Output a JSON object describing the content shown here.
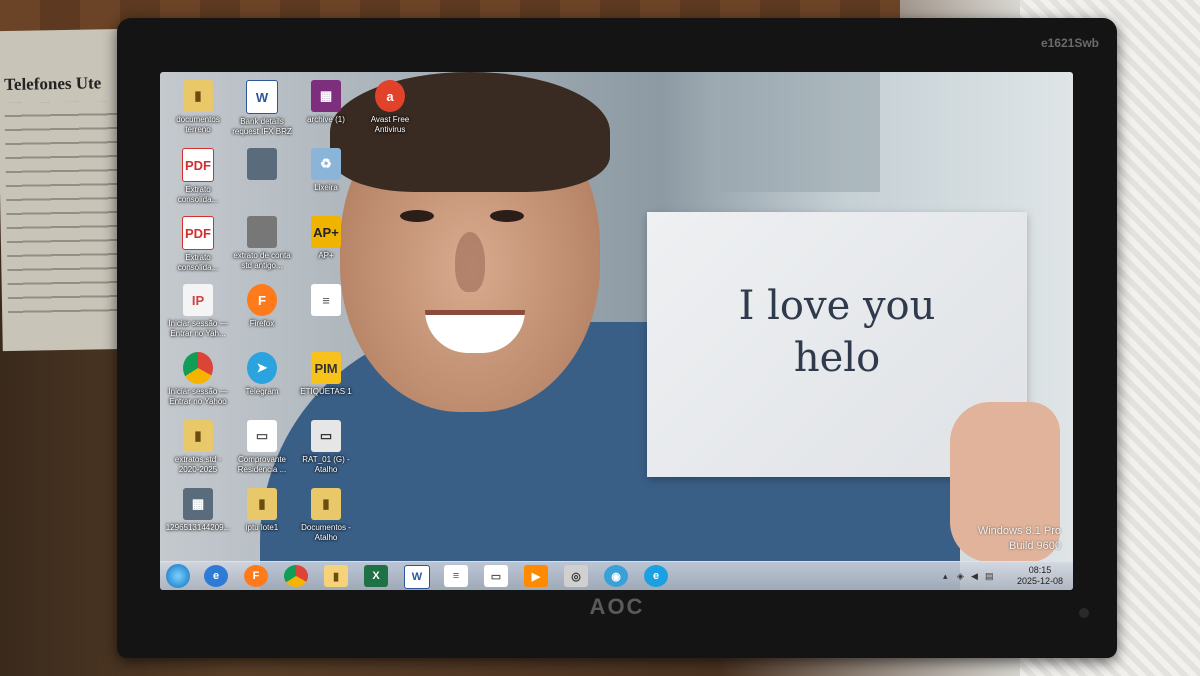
{
  "background": {
    "poster_title": "Telefones Ute"
  },
  "monitor": {
    "brand": "AOC",
    "model": "e1621Swb"
  },
  "wallpaper": {
    "sign_lines": [
      "I love you",
      "helo"
    ]
  },
  "desktop_icons": [
    {
      "label": "documentos terreno",
      "icon": "folder-icon",
      "glyph": "▮"
    },
    {
      "label": "Bank details request IFX BRZ",
      "icon": "word-icon",
      "glyph": "W"
    },
    {
      "label": "archive (1)",
      "icon": "winrar-icon",
      "glyph": "▦"
    },
    {
      "label": "Avast Free Antivirus",
      "icon": "avast-icon",
      "glyph": "a"
    },
    {
      "label": "Extrato consolida...",
      "icon": "pdf-icon",
      "glyph": "PDF"
    },
    {
      "label": "",
      "icon": "image-icon",
      "glyph": ""
    },
    {
      "label": "Lixeira",
      "icon": "recycle-bin-icon",
      "glyph": "♻"
    },
    {
      "label": "",
      "icon": "pdf-icon",
      "glyph": "PDF"
    },
    {
      "label": "Extrato consolida...",
      "icon": "pdf-icon",
      "glyph": "PDF"
    },
    {
      "label": "extrato de conta std antigo...",
      "icon": "file-icon",
      "glyph": ""
    },
    {
      "label": "AP+",
      "icon": "app-icon",
      "glyph": "AP+"
    },
    {
      "label": "Iniciar sessão — Entrar no Yah...",
      "icon": "tab-icon",
      "glyph": "IP"
    },
    {
      "label": "Firefox",
      "icon": "firefox-icon",
      "glyph": "F"
    },
    {
      "label": "",
      "icon": "document-icon",
      "glyph": "≡"
    },
    {
      "label": "Iniciar sessão — Entrar no Yahoo",
      "icon": "chrome-icon",
      "glyph": ""
    },
    {
      "label": "Telegram",
      "icon": "telegram-icon",
      "glyph": "➤"
    },
    {
      "label": "ETIQUETAS 1",
      "icon": "label-app-icon",
      "glyph": "PIM"
    },
    {
      "label": "extratos std - 2020-2025",
      "icon": "folder-icon",
      "glyph": "▮"
    },
    {
      "label": "Comprovante Residencia ...",
      "icon": "document-icon",
      "glyph": "▭"
    },
    {
      "label": "RAT_01 (G) - Atalho",
      "icon": "drive-icon",
      "glyph": "▭"
    },
    {
      "label": "1296513144209...",
      "icon": "image-icon",
      "glyph": "▦"
    },
    {
      "label": "iptu lote1",
      "icon": "folder-icon",
      "glyph": "▮"
    },
    {
      "label": "Documentos - Atalho",
      "icon": "folder-icon",
      "glyph": "▮"
    }
  ],
  "taskbar": {
    "items": [
      {
        "name": "edge-icon",
        "glyph": "e"
      },
      {
        "name": "firefox-icon",
        "glyph": "F"
      },
      {
        "name": "chrome-icon",
        "glyph": ""
      },
      {
        "name": "file-explorer-icon",
        "glyph": "▮"
      },
      {
        "name": "excel-icon",
        "glyph": "X"
      },
      {
        "name": "word-icon",
        "glyph": "W"
      },
      {
        "name": "document-icon",
        "glyph": "≡"
      },
      {
        "name": "document-icon",
        "glyph": "▭"
      },
      {
        "name": "media-player-icon",
        "glyph": "▶"
      },
      {
        "name": "app-icon",
        "glyph": "◎"
      },
      {
        "name": "webcam-icon",
        "glyph": "◉"
      },
      {
        "name": "internet-explorer-icon",
        "glyph": "e"
      }
    ],
    "time": "08:15",
    "date": "2025-12-08"
  },
  "watermark": {
    "line1": "Windows 8.1 Pro",
    "line2": "Build 9600"
  }
}
